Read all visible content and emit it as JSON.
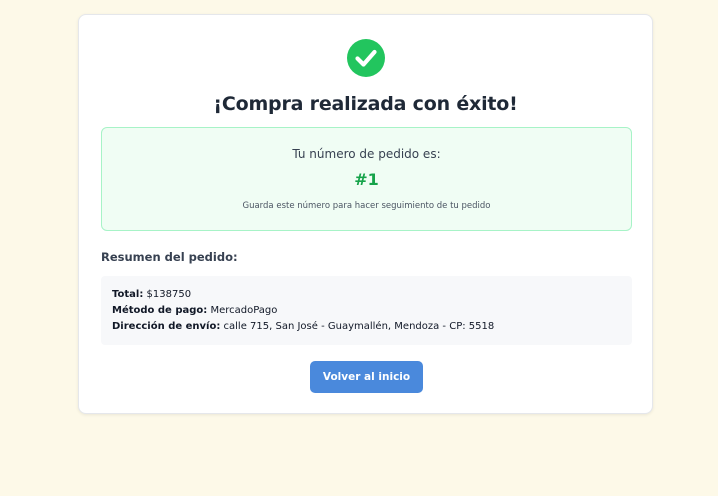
{
  "colors": {
    "background": "#fdf9e8",
    "success": "#22c55e",
    "order_number": "#16a34a",
    "button": "#4a89dc"
  },
  "success_icon": "check-circle-icon",
  "title": "¡Compra realizada con éxito!",
  "order": {
    "label": "Tu número de pedido es:",
    "number": "#1",
    "hint": "Guarda este número para hacer seguimiento de tu pedido"
  },
  "summary": {
    "heading": "Resumen del pedido:",
    "total_label": "Total:",
    "total_value": "$138750",
    "payment_label": "Método de pago:",
    "payment_value": "MercadoPago",
    "address_label": "Dirección de envío:",
    "address_value": "calle 715, San José - Guaymallén, Mendoza - CP: 5518"
  },
  "actions": {
    "home_label": "Volver al inicio"
  }
}
